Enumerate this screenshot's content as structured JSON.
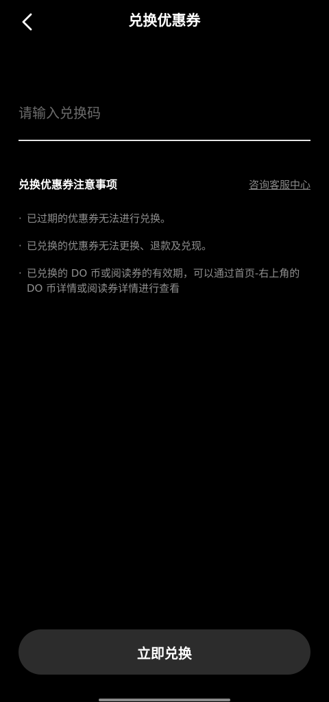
{
  "header": {
    "title": "兑换优惠券",
    "back_icon": "chevron-left-icon"
  },
  "form": {
    "code_placeholder": "请输入兑换码",
    "code_value": ""
  },
  "notice": {
    "title": "兑换优惠券注意事项",
    "support_link": "咨询客服中心",
    "bullet": "·",
    "items": [
      "已过期的优惠券无法进行兑换。",
      "已兑换的优惠券无法更换、退款及兑现。",
      "已兑换的 DO 币或阅读券的有效期，可以通过首页-右上角的 DO 币详情或阅读券详情进行查看"
    ]
  },
  "actions": {
    "redeem_label": "立即兑换"
  },
  "colors": {
    "background": "#000000",
    "button": "#2c2c2c",
    "muted_text": "#8f8f8f",
    "underline": "#e6e6e6"
  }
}
